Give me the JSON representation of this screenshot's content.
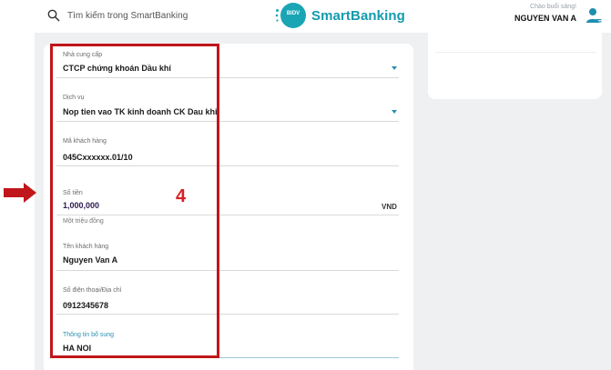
{
  "header": {
    "search_placeholder": "Tìm kiếm trong SmartBanking",
    "logo_badge": "BIDV",
    "logo_text": "SmartBanking",
    "greeting": "Chào buổi sáng!",
    "username": "NGUYEN VAN A"
  },
  "form": {
    "provider": {
      "label": "Nhà cung cấp",
      "value": "CTCP chứng khoán Dầu khí"
    },
    "service": {
      "label": "Dịch vụ",
      "value": "Nop tien vao TK kinh doanh CK Dau khi"
    },
    "customer_code": {
      "label": "Mã khách hàng",
      "value": "045Cxxxxxx.01/10"
    },
    "amount": {
      "label": "Số tiền",
      "value": "1,000,000",
      "currency": "VND",
      "in_words": "Một triệu đồng"
    },
    "customer_name": {
      "label": "Tên khách hàng",
      "value": "Nguyen Van A"
    },
    "phone_address": {
      "label": "Số điện thoại/Địa chỉ",
      "value": "0912345678"
    },
    "additional_info": {
      "label": "Thông tin bổ sung",
      "value": "HA NOI"
    }
  },
  "annotation": {
    "step": "4"
  },
  "colors": {
    "brand": "#139aad",
    "accent": "#2a8fb0",
    "annotation_red": "#c0161b"
  }
}
